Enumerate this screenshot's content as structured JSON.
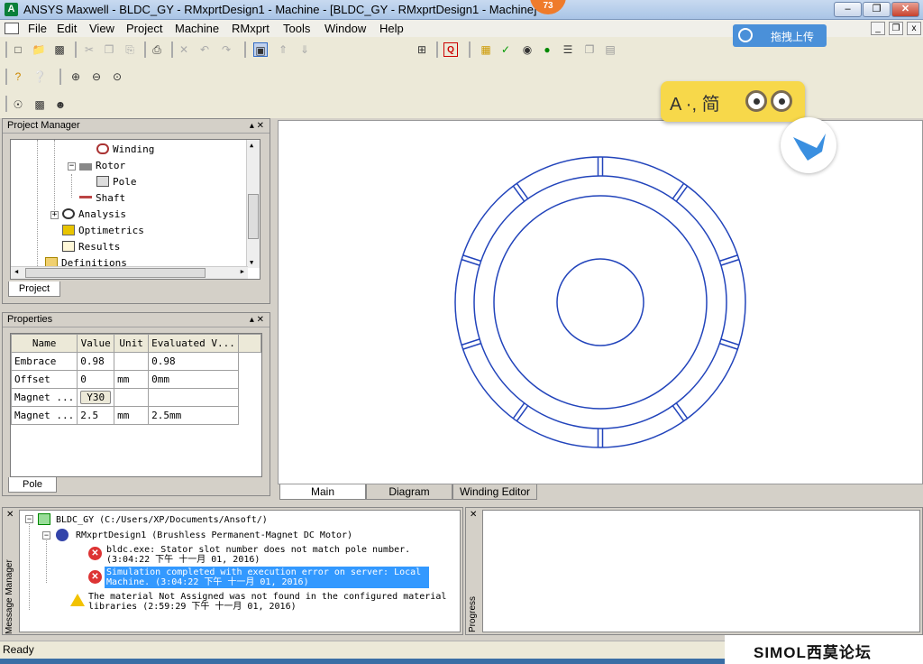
{
  "window": {
    "title": "ANSYS Maxwell - BLDC_GY - RMxprtDesign1 - Machine - [BLDC_GY - RMxprtDesign1 - Machine]",
    "app_icon": "maxwell-app-icon",
    "notify_badge": "73",
    "min_label": "–",
    "max_label": "❐",
    "close_label": "✕"
  },
  "menu": {
    "items": [
      "File",
      "Edit",
      "View",
      "Project",
      "Machine",
      "RMxprt",
      "Tools",
      "Window",
      "Help"
    ],
    "mdi_min": "_",
    "mdi_restore": "❐",
    "mdi_close": "x"
  },
  "upload_button": {
    "label": "拖拽上传",
    "icon": "cloud-icon"
  },
  "floater": {
    "label": "A ·, 简",
    "color": "#f7d84a"
  },
  "project_manager": {
    "title": "Project Manager",
    "controls": "▴ ✕",
    "tree": [
      {
        "label": "Winding",
        "icon": "winding-icon"
      },
      {
        "label": "Rotor",
        "icon": "rotor-icon"
      },
      {
        "label": "Pole",
        "icon": "pole-icon"
      },
      {
        "label": "Shaft",
        "icon": "shaft-icon"
      },
      {
        "label": "Analysis",
        "icon": "analysis-icon"
      },
      {
        "label": "Optimetrics",
        "icon": "optimetrics-icon"
      },
      {
        "label": "Results",
        "icon": "results-icon"
      },
      {
        "label": "Definitions",
        "icon": "folder-icon"
      }
    ],
    "tab": "Project"
  },
  "properties": {
    "title": "Properties",
    "controls": "▴ ✕",
    "columns": [
      "Name",
      "Value",
      "Unit",
      "Evaluated V..."
    ],
    "rows": [
      {
        "name": "Embrace",
        "value": "0.98",
        "unit": "",
        "evaluated": "0.98"
      },
      {
        "name": "Offset",
        "value": "0",
        "unit": "mm",
        "evaluated": "0mm"
      },
      {
        "name": "Magnet ...",
        "value": "Y30",
        "unit": "",
        "evaluated": ""
      },
      {
        "name": "Magnet ...",
        "value": "2.5",
        "unit": "mm",
        "evaluated": "2.5mm"
      }
    ],
    "tab": "Pole"
  },
  "view_tabs": [
    "Main",
    "Diagram",
    "Winding Editor"
  ],
  "drawing": {
    "stroke_color": "#2244bb",
    "slot_count": 10
  },
  "message_manager": {
    "side_label": "Message Manager",
    "project": "BLDC_GY (C:/Users/XP/Documents/Ansoft/)",
    "design": "RMxprtDesign1 (Brushless Permanent-Magnet DC Motor)",
    "messages": [
      {
        "type": "error",
        "line1": "bldc.exe: Stator slot number does not match pole number.",
        "line2": "(3:04:22 下午  十一月 01, 2016)"
      },
      {
        "type": "error",
        "line1": "Simulation completed with execution error on server: Local",
        "line2": "Machine. (3:04:22 下午  十一月 01, 2016)"
      },
      {
        "type": "warning",
        "line1": "The material Not Assigned was not found in the configured material",
        "line2": "libraries (2:59:29 下午  十一月 01, 2016)"
      }
    ]
  },
  "progress": {
    "side_label": "Progress"
  },
  "status": {
    "text": "Ready"
  },
  "watermark": {
    "text": "SIMOL西莫论坛"
  }
}
